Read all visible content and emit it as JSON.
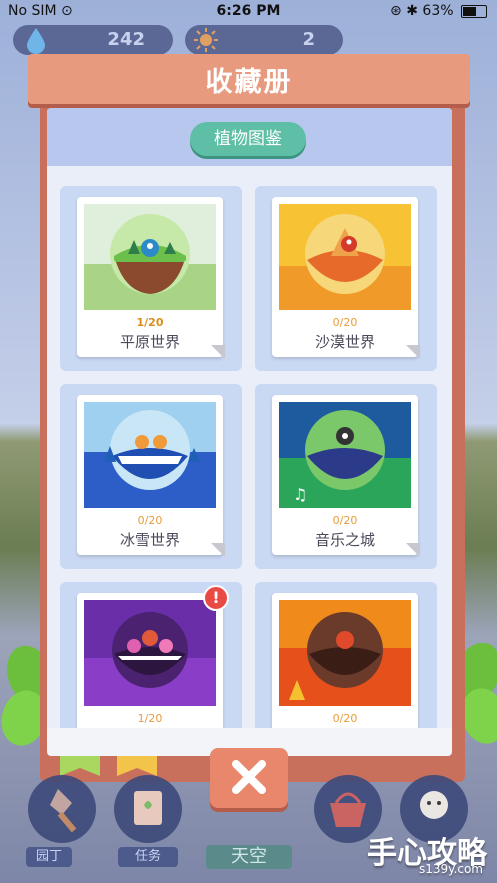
{
  "status_bar": {
    "carrier": "No SIM",
    "time": "6:26 PM",
    "battery_percent": "63%",
    "battery_level": 0.63
  },
  "resources": {
    "water": "242",
    "sun": "2"
  },
  "collection": {
    "title": "收藏册",
    "tab_label": "植物图鉴",
    "worlds": [
      {
        "name": "平原世界",
        "progress": "1/20"
      },
      {
        "name": "沙漠世界",
        "progress": "0/20"
      },
      {
        "name": "冰雪世界",
        "progress": "0/20"
      },
      {
        "name": "音乐之城",
        "progress": "0/20"
      },
      {
        "name": "",
        "progress": "1/20",
        "badge": "!"
      },
      {
        "name": "",
        "progress": "0/20"
      }
    ]
  },
  "nav": {
    "gardener": "园丁",
    "task": "任务",
    "sky": "天空"
  },
  "watermark": {
    "main": "手心攻略",
    "url": "s139y.com"
  },
  "colors": {
    "header": "#e89a7e",
    "tab": "#5fbfa6",
    "panel": "#c8705c"
  }
}
